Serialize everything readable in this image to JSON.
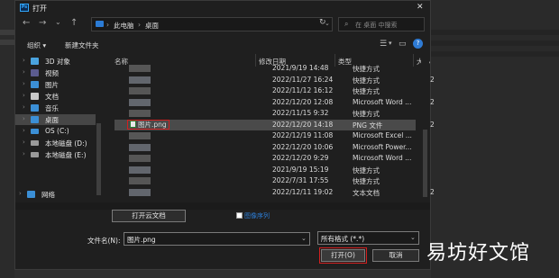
{
  "window": {
    "app_icon": "Ps",
    "title": "打开",
    "close_glyph": "✕"
  },
  "nav": {
    "back": "←",
    "forward": "→",
    "up_dropdown": "⌄",
    "up": "↑",
    "refresh": "↻",
    "breadcrumb": [
      "此电脑",
      "桌面"
    ],
    "separator": "›",
    "search_placeholder": "在 桌面 中搜索"
  },
  "toolbar": {
    "organize": "组织 ▾",
    "new_folder": "新建文件夹",
    "view_icon": "☰",
    "view_dropdown": "▾",
    "preview_icon": "▭",
    "help": "?"
  },
  "sidebar": [
    {
      "label": "3D 对象",
      "icon": "cube-icon",
      "color": "#4aa3df"
    },
    {
      "label": "视频",
      "icon": "video-icon",
      "color": "#5b5b8f"
    },
    {
      "label": "图片",
      "icon": "pictures-icon",
      "color": "#3b8fd6"
    },
    {
      "label": "文档",
      "icon": "documents-icon",
      "color": "#c9c9c9"
    },
    {
      "label": "音乐",
      "icon": "music-icon",
      "color": "#3b8fd6"
    },
    {
      "label": "桌面",
      "icon": "desktop-icon",
      "color": "#3b8fd6",
      "selected": true
    },
    {
      "label": "OS (C:)",
      "icon": "drive-icon",
      "color": "#3b8fd6"
    },
    {
      "label": "本地磁盘 (D:)",
      "icon": "drive-icon",
      "color": "#9a9a9a"
    },
    {
      "label": "本地磁盘 (E:)",
      "icon": "drive-icon",
      "color": "#9a9a9a"
    },
    {
      "label": "网络",
      "icon": "network-icon",
      "color": "#3b8fd6"
    }
  ],
  "columns": {
    "name": "名称",
    "modified": "修改日期",
    "type": "类型",
    "size": "大小"
  },
  "files": [
    {
      "date": "2021/9/19 14:48",
      "type": "快捷方式",
      "size": ""
    },
    {
      "date": "2022/11/27 16:24",
      "type": "快捷方式",
      "size": "2"
    },
    {
      "date": "2022/11/12 16:12",
      "type": "快捷方式",
      "size": ""
    },
    {
      "date": "2022/12/20 12:08",
      "type": "Microsoft Word ...",
      "size": "2"
    },
    {
      "date": "2022/11/15 9:32",
      "type": "快捷方式",
      "size": ""
    },
    {
      "name": "图片.png",
      "date": "2022/12/20 14:18",
      "type": "PNG 文件",
      "size": "2",
      "selected": true
    },
    {
      "date": "2022/12/19 11:08",
      "type": "Microsoft Excel ...",
      "size": ""
    },
    {
      "date": "2022/12/20 10:06",
      "type": "Microsoft Power...",
      "size": ""
    },
    {
      "date": "2022/12/20 9:29",
      "type": "Microsoft Word ...",
      "size": ""
    },
    {
      "date": "2021/9/19 15:19",
      "type": "快捷方式",
      "size": ""
    },
    {
      "date": "2022/7/31 17:55",
      "type": "快捷方式",
      "size": ""
    },
    {
      "date": "2022/12/11 19:02",
      "type": "文本文档",
      "size": "2"
    }
  ],
  "footer": {
    "open_cloud": "打开云文档",
    "image_sequence": "图像序列",
    "filename_label": "文件名(N):",
    "filename_value": "图片.png",
    "filter_value": "所有格式 (*.*)",
    "dropdown_glyph": "⌄",
    "open": "打开(O)",
    "cancel": "取消"
  },
  "watermark": "易坊好文馆"
}
